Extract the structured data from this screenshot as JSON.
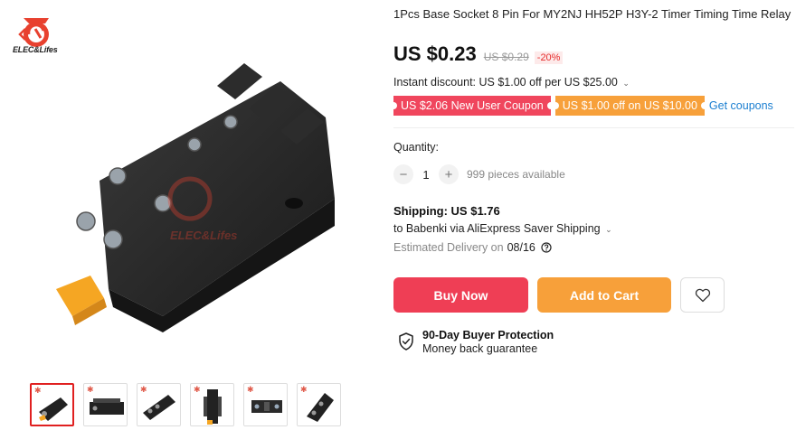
{
  "brand": {
    "logo_text": "ELEC&Lifes",
    "watermark": "ELEC&Lifes"
  },
  "product": {
    "title": "1Pcs Base Socket 8 Pin For MY2NJ HH52P H3Y-2 Timer Timing Time Relay",
    "price": "US $0.23",
    "old_price": "US $0.29",
    "discount": "-20%",
    "instant_discount": "Instant discount: US $1.00 off per US $25.00",
    "coupons": [
      "US $2.06 New User Coupon",
      "US $1.00 off on US $10.00"
    ],
    "get_coupons": "Get coupons"
  },
  "quantity": {
    "label": "Quantity:",
    "minus": "−",
    "value": "1",
    "plus": "+",
    "available": "999 pieces available"
  },
  "shipping": {
    "title": "Shipping: US $1.76",
    "to": "to Babenki via AliExpress Saver Shipping",
    "delivery_label": "Estimated Delivery on",
    "delivery_date": "08/16"
  },
  "actions": {
    "buy_now": "Buy Now",
    "add_to_cart": "Add to Cart",
    "wishlist_icon": "heart-icon"
  },
  "protection": {
    "title": "90-Day Buyer Protection",
    "subtitle": "Money back guarantee",
    "icon": "shield-check-icon"
  },
  "gallery": {
    "thumbnail_count": 6,
    "active_index": 0
  },
  "colors": {
    "buy": "#ef3e55",
    "cart": "#f7a03a",
    "coupon_red": "#f0465d",
    "coupon_orange": "#f7a03a",
    "link": "#1a7ed0",
    "discount": "#e62e2e"
  }
}
